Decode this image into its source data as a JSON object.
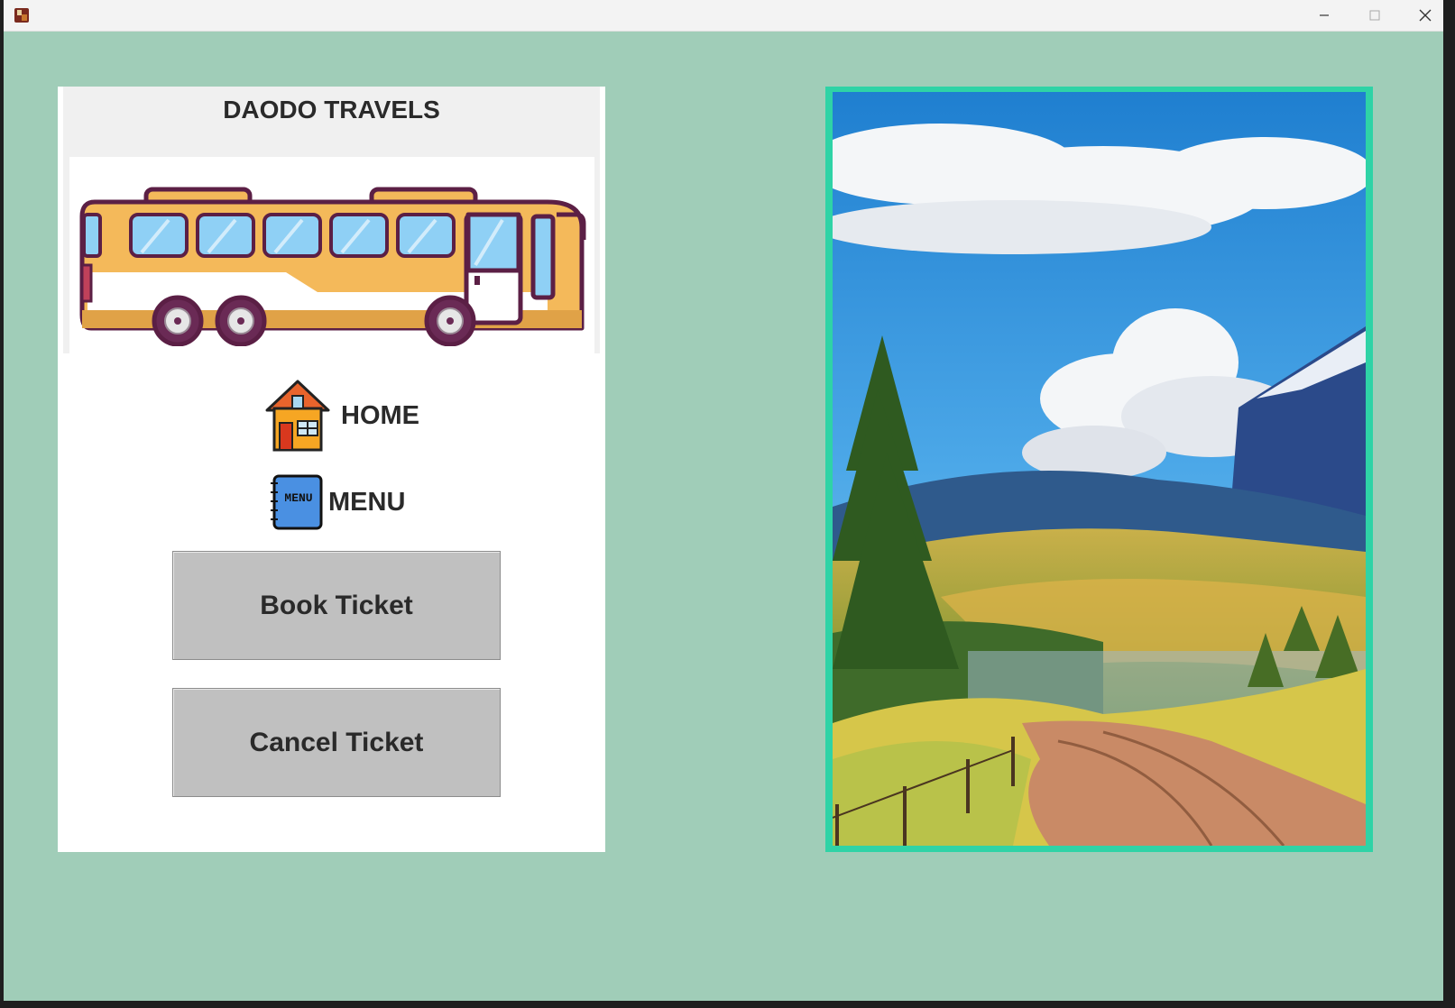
{
  "window": {
    "title": ""
  },
  "panel": {
    "title": "DAODO TRAVELS",
    "nav": [
      {
        "label": "HOME",
        "icon": "house-icon"
      },
      {
        "label": "MENU",
        "icon": "menu-book-icon",
        "icon_text": "MENU"
      }
    ],
    "buttons": {
      "book": "Book Ticket",
      "cancel": "Cancel Ticket"
    }
  },
  "colors": {
    "background": "#a0cdb8",
    "frame_accent": "#2fd3a6",
    "button_bg": "#c0c0c0",
    "bus_body": "#f4b95a"
  }
}
